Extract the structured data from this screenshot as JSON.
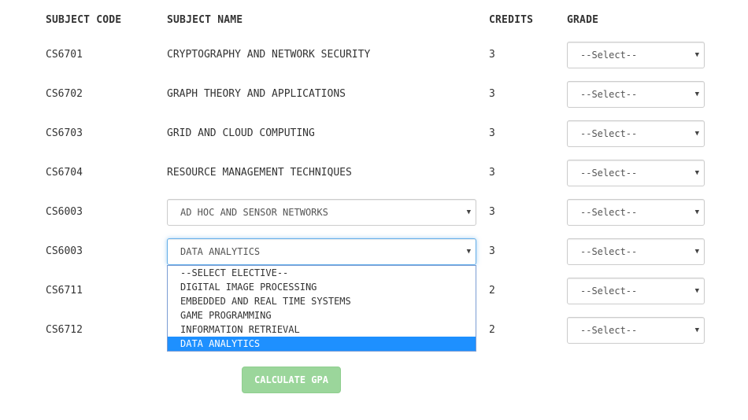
{
  "headers": {
    "code": "SUBJECT CODE",
    "name": "SUBJECT NAME",
    "credits": "CREDITS",
    "grade": "GRADE"
  },
  "rows": [
    {
      "code": "CS6701",
      "name": "CRYPTOGRAPHY AND NETWORK SECURITY",
      "credits": "3",
      "grade": "--Select--"
    },
    {
      "code": "CS6702",
      "name": "GRAPH THEORY AND APPLICATIONS",
      "credits": "3",
      "grade": "--Select--"
    },
    {
      "code": "CS6703",
      "name": "GRID AND CLOUD COMPUTING",
      "credits": "3",
      "grade": "--Select--"
    },
    {
      "code": "CS6704",
      "name": "RESOURCE MANAGEMENT TECHNIQUES",
      "credits": "3",
      "grade": "--Select--"
    },
    {
      "code": "CS6003",
      "name": "AD HOC AND SENSOR NETWORKS",
      "credits": "3",
      "grade": "--Select--"
    },
    {
      "code": "CS6003",
      "name": "DATA ANALYTICS",
      "credits": "3",
      "grade": "--Select--"
    },
    {
      "code": "CS6711",
      "name": "",
      "credits": "2",
      "grade": "--Select--"
    },
    {
      "code": "CS6712",
      "name": "",
      "credits": "2",
      "grade": "--Select--"
    }
  ],
  "elective_options": [
    "--SELECT ELECTIVE--",
    "DIGITAL IMAGE PROCESSING",
    "EMBEDDED AND REAL TIME SYSTEMS",
    "GAME PROGRAMMING",
    "INFORMATION RETRIEVAL",
    "DATA ANALYTICS"
  ],
  "icons": {
    "dropdown_caret": "▼"
  },
  "button": {
    "label": "CALCULATE GPA"
  },
  "colors": {
    "selected_option": "#1e90ff",
    "button": "#9bd69b",
    "focus_border": "#66afe9"
  }
}
